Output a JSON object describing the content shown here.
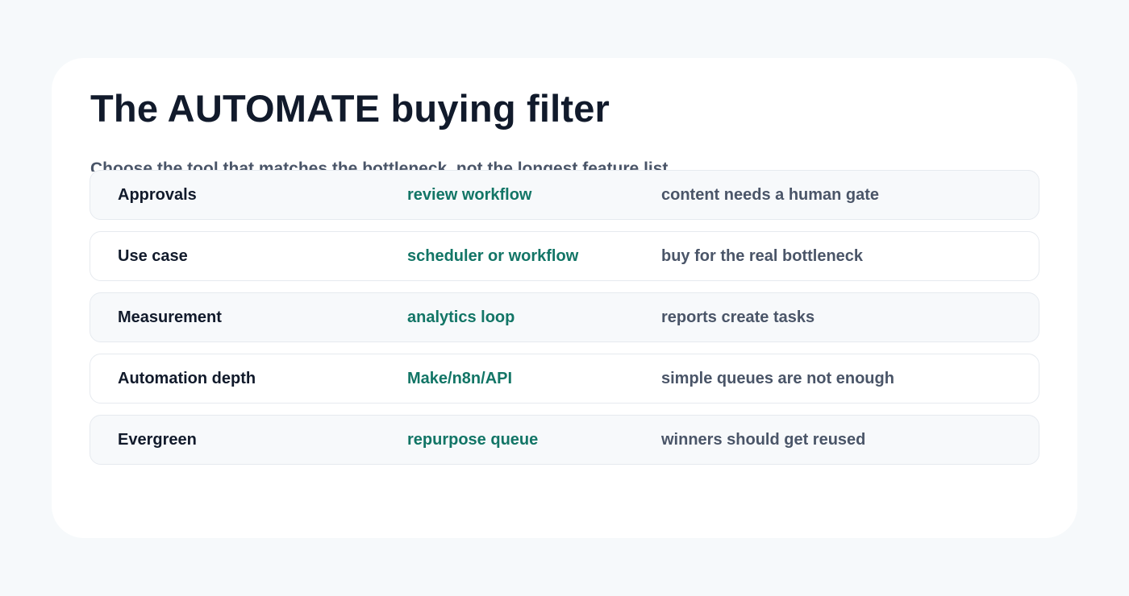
{
  "card": {
    "title": "The AUTOMATE buying filter",
    "subtitle": "Choose the tool that matches the bottleneck, not the longest feature list."
  },
  "rows": [
    {
      "factor": "Approvals",
      "tool": "review workflow",
      "signal": "content needs a human gate"
    },
    {
      "factor": "Use case",
      "tool": "scheduler or workflow",
      "signal": "buy for the real bottleneck"
    },
    {
      "factor": "Measurement",
      "tool": "analytics loop",
      "signal": "reports create tasks"
    },
    {
      "factor": "Automation depth",
      "tool": "Make/n8n/API",
      "signal": "simple queues are not enough"
    },
    {
      "factor": "Evergreen",
      "tool": "repurpose queue",
      "signal": "winners should get reused"
    }
  ],
  "colors": {
    "background": "#f6f9fb",
    "card": "#ffffff",
    "title": "#111a2b",
    "accent": "#127566",
    "muted": "#4a5568",
    "row_alt": "#f7f9fb",
    "row_border": "#e6eaef"
  }
}
